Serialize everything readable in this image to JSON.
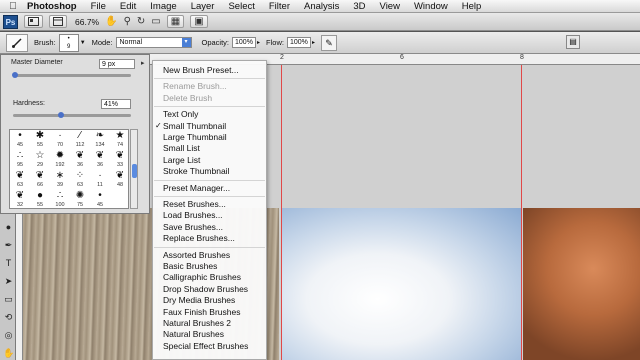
{
  "menubar": {
    "apple": "",
    "items": [
      "Photoshop",
      "File",
      "Edit",
      "Image",
      "Layer",
      "Select",
      "Filter",
      "Analysis",
      "3D",
      "View",
      "Window",
      "Help"
    ]
  },
  "appbar": {
    "logo": "Ps",
    "zoom": "66.7%"
  },
  "options": {
    "brush_label": "Brush:",
    "brush_size": "9",
    "mode_label": "Mode:",
    "mode_value": "Normal",
    "opacity_label": "Opacity:",
    "opacity_value": "100%",
    "flow_label": "Flow:",
    "flow_value": "100%"
  },
  "ruler": {
    "marks": [
      "2",
      "6",
      "8"
    ]
  },
  "brush_panel": {
    "master_diameter_label": "Master Diameter",
    "master_diameter_value": "9 px",
    "master_diameter_level": 0.02,
    "hardness_label": "Hardness:",
    "hardness_value": "41%",
    "hardness_level": 0.41,
    "presets": [
      {
        "glyph": "•",
        "num": "45"
      },
      {
        "glyph": "✱",
        "num": "55"
      },
      {
        "glyph": "·",
        "num": "70"
      },
      {
        "glyph": "⁄",
        "num": "112"
      },
      {
        "glyph": "❧",
        "num": "134"
      },
      {
        "glyph": "★",
        "num": "74"
      },
      {
        "glyph": "∴",
        "num": "95"
      },
      {
        "glyph": "☆",
        "num": "29"
      },
      {
        "glyph": "✹",
        "num": "192"
      },
      {
        "glyph": "❦",
        "num": "36"
      },
      {
        "glyph": "❦",
        "num": "36"
      },
      {
        "glyph": "❦",
        "num": "33"
      },
      {
        "glyph": "❦",
        "num": "63"
      },
      {
        "glyph": "❦",
        "num": "66"
      },
      {
        "glyph": "∗",
        "num": "39"
      },
      {
        "glyph": "⁘",
        "num": "63"
      },
      {
        "glyph": "·",
        "num": "11"
      },
      {
        "glyph": "❦",
        "num": "48"
      },
      {
        "glyph": "❦",
        "num": "32"
      },
      {
        "glyph": "●",
        "num": "55"
      },
      {
        "glyph": "∴",
        "num": "100"
      },
      {
        "glyph": "✺",
        "num": "75"
      },
      {
        "glyph": "•",
        "num": "45"
      },
      {
        "glyph": "",
        "num": ""
      }
    ]
  },
  "menu": {
    "items": [
      {
        "label": "New Brush Preset...",
        "disabled": false,
        "checked": false
      },
      {
        "sep": true
      },
      {
        "label": "Rename Brush...",
        "disabled": true,
        "checked": false
      },
      {
        "label": "Delete Brush",
        "disabled": true,
        "checked": false
      },
      {
        "sep": true
      },
      {
        "label": "Text Only",
        "disabled": false,
        "checked": false
      },
      {
        "label": "Small Thumbnail",
        "disabled": false,
        "checked": true
      },
      {
        "label": "Large Thumbnail",
        "disabled": false,
        "checked": false
      },
      {
        "label": "Small List",
        "disabled": false,
        "checked": false
      },
      {
        "label": "Large List",
        "disabled": false,
        "checked": false
      },
      {
        "label": "Stroke Thumbnail",
        "disabled": false,
        "checked": false
      },
      {
        "sep": true
      },
      {
        "label": "Preset Manager...",
        "disabled": false,
        "checked": false
      },
      {
        "sep": true
      },
      {
        "label": "Reset Brushes...",
        "disabled": false,
        "checked": false
      },
      {
        "label": "Load Brushes...",
        "disabled": false,
        "checked": false
      },
      {
        "label": "Save Brushes...",
        "disabled": false,
        "checked": false
      },
      {
        "label": "Replace Brushes...",
        "disabled": false,
        "checked": false
      },
      {
        "sep": true
      },
      {
        "label": "Assorted Brushes",
        "disabled": false,
        "checked": false
      },
      {
        "label": "Basic Brushes",
        "disabled": false,
        "checked": false
      },
      {
        "label": "Calligraphic Brushes",
        "disabled": false,
        "checked": false
      },
      {
        "label": "Drop Shadow Brushes",
        "disabled": false,
        "checked": false
      },
      {
        "label": "Dry Media Brushes",
        "disabled": false,
        "checked": false
      },
      {
        "label": "Faux Finish Brushes",
        "disabled": false,
        "checked": false
      },
      {
        "label": "Natural Brushes 2",
        "disabled": false,
        "checked": false
      },
      {
        "label": "Natural Brushes",
        "disabled": false,
        "checked": false
      },
      {
        "label": "Special Effect Brushes",
        "disabled": false,
        "checked": false
      }
    ]
  }
}
